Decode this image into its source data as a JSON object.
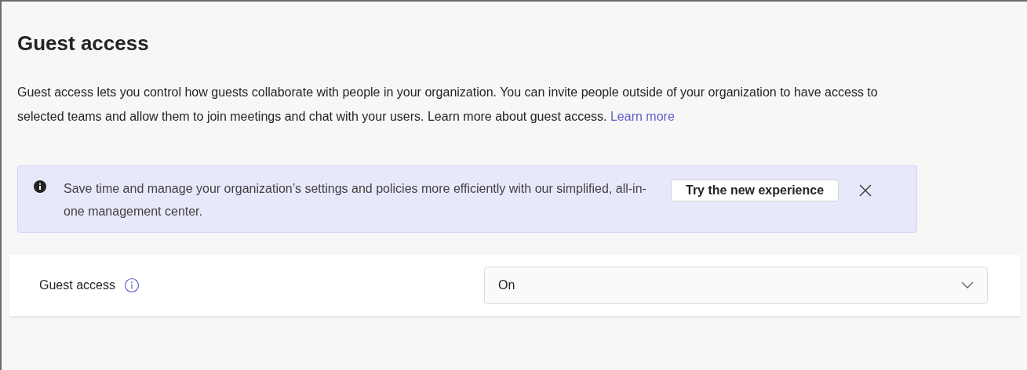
{
  "title": "Guest access",
  "description": {
    "text": "Guest access lets you control how guests collaborate with people in your organization. You can invite people outside of your organization to have access to selected teams and allow them to join meetings and chat with your users. Learn more about guest access.",
    "link": "Learn more"
  },
  "banner": {
    "text": "Save time and manage your organization’s settings and policies more efficiently with our simplified, all-in-one management center.",
    "button": "Try the new experience"
  },
  "settings": [
    {
      "label": "Guest access",
      "kind": "dropdown",
      "value": "On"
    }
  ]
}
